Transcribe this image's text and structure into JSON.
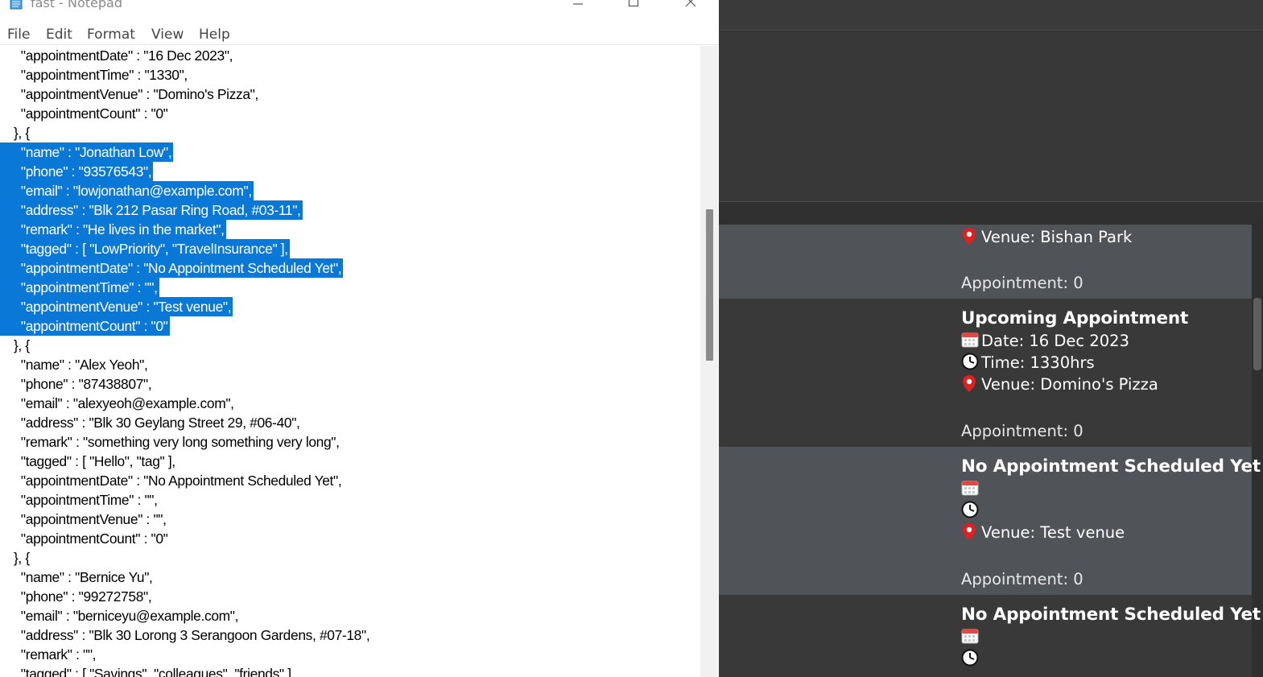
{
  "notepad": {
    "title": "fast - Notepad",
    "menu": [
      "File",
      "Edit",
      "Format",
      "View",
      "Help"
    ],
    "lines": [
      {
        "text": "    \"appointmentDate\" : \"16 Dec 2023\",",
        "selected": false
      },
      {
        "text": "    \"appointmentTime\" : \"1330\",",
        "selected": false
      },
      {
        "text": "    \"appointmentVenue\" : \"Domino's Pizza\",",
        "selected": false
      },
      {
        "text": "    \"appointmentCount\" : \"0\"",
        "selected": false
      },
      {
        "text": "  }, {",
        "selected": false
      },
      {
        "text": "    \"name\" : \"Jonathan Low\",",
        "selected": true
      },
      {
        "text": "    \"phone\" : \"93576543\",",
        "selected": true
      },
      {
        "text": "    \"email\" : \"lowjonathan@example.com\",",
        "selected": true
      },
      {
        "text": "    \"address\" : \"Blk 212 Pasar Ring Road, #03-11\",",
        "selected": true
      },
      {
        "text": "    \"remark\" : \"He lives in the market\",",
        "selected": true
      },
      {
        "text": "    \"tagged\" : [ \"LowPriority\", \"TravelInsurance\" ],",
        "selected": true
      },
      {
        "text": "    \"appointmentDate\" : \"No Appointment Scheduled Yet\",",
        "selected": true
      },
      {
        "text": "    \"appointmentTime\" : \"\",",
        "selected": true
      },
      {
        "text": "    \"appointmentVenue\" : \"Test venue\",",
        "selected": true
      },
      {
        "text": "    \"appointmentCount\" : \"0\"",
        "selected": true
      },
      {
        "text": "  }, {",
        "selected": false
      },
      {
        "text": "    \"name\" : \"Alex Yeoh\",",
        "selected": false
      },
      {
        "text": "    \"phone\" : \"87438807\",",
        "selected": false
      },
      {
        "text": "    \"email\" : \"alexyeoh@example.com\",",
        "selected": false
      },
      {
        "text": "    \"address\" : \"Blk 30 Geylang Street 29, #06-40\",",
        "selected": false
      },
      {
        "text": "    \"remark\" : \"something very long something very long\",",
        "selected": false
      },
      {
        "text": "    \"tagged\" : [ \"Hello\", \"tag\" ],",
        "selected": false
      },
      {
        "text": "    \"appointmentDate\" : \"No Appointment Scheduled Yet\",",
        "selected": false
      },
      {
        "text": "    \"appointmentTime\" : \"\",",
        "selected": false
      },
      {
        "text": "    \"appointmentVenue\" : \"\",",
        "selected": false
      },
      {
        "text": "    \"appointmentCount\" : \"0\"",
        "selected": false
      },
      {
        "text": "  }, {",
        "selected": false
      },
      {
        "text": "    \"name\" : \"Bernice Yu\",",
        "selected": false
      },
      {
        "text": "    \"phone\" : \"99272758\",",
        "selected": false
      },
      {
        "text": "    \"email\" : \"berniceyu@example.com\",",
        "selected": false
      },
      {
        "text": "    \"address\" : \"Blk 30 Lorong 3 Serangoon Gardens, #07-18\",",
        "selected": false
      },
      {
        "text": "    \"remark\" : \"\",",
        "selected": false
      },
      {
        "text": "    \"tagged\" : [ \"Savings\", \"colleagues\", \"friends\" ],",
        "selected": false
      }
    ]
  },
  "app": {
    "cards": [
      {
        "title": "",
        "date": null,
        "time": null,
        "venue": "Venue: Bishan Park",
        "count": "Appointment: 0",
        "style": "alt"
      },
      {
        "title": "Upcoming Appointment",
        "date": "Date: 16 Dec 2023",
        "time": "Time: 1330hrs",
        "venue": "Venue: Domino's Pizza",
        "count": "Appointment: 0",
        "style": "dark"
      },
      {
        "title": "No Appointment Scheduled Yet",
        "date": "",
        "time": "",
        "venue": "Venue: Test venue",
        "count": "Appointment: 0",
        "style": "alt"
      },
      {
        "title": "No Appointment Scheduled Yet",
        "date": "",
        "time": "",
        "venue": null,
        "count": null,
        "style": "dark"
      }
    ],
    "icons": {
      "date": "calendar-icon",
      "time": "clock-icon",
      "venue": "map-pin-icon"
    },
    "colors": {
      "selection": "#0a78d7",
      "pin": "#e02020",
      "card_alt": "#505357",
      "card_dark": "#393939"
    }
  }
}
